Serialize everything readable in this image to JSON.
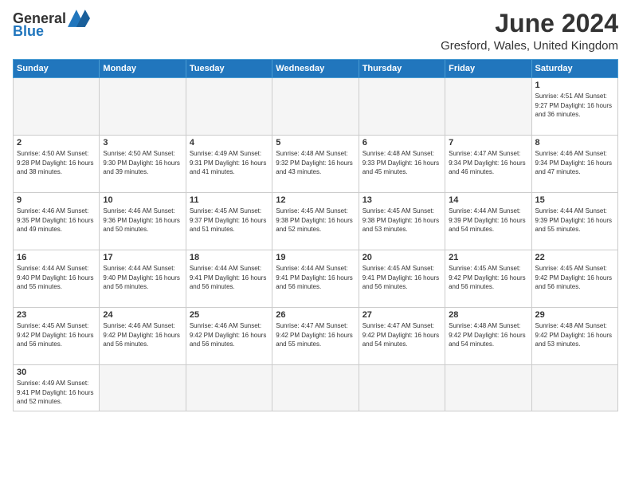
{
  "header": {
    "logo_general": "General",
    "logo_blue": "Blue",
    "month_title": "June 2024",
    "location": "Gresford, Wales, United Kingdom"
  },
  "days_of_week": [
    "Sunday",
    "Monday",
    "Tuesday",
    "Wednesday",
    "Thursday",
    "Friday",
    "Saturday"
  ],
  "weeks": [
    [
      {
        "day": "",
        "info": ""
      },
      {
        "day": "",
        "info": ""
      },
      {
        "day": "",
        "info": ""
      },
      {
        "day": "",
        "info": ""
      },
      {
        "day": "",
        "info": ""
      },
      {
        "day": "",
        "info": ""
      },
      {
        "day": "1",
        "info": "Sunrise: 4:51 AM\nSunset: 9:27 PM\nDaylight: 16 hours and 36 minutes."
      }
    ],
    [
      {
        "day": "2",
        "info": "Sunrise: 4:50 AM\nSunset: 9:28 PM\nDaylight: 16 hours and 38 minutes."
      },
      {
        "day": "3",
        "info": "Sunrise: 4:50 AM\nSunset: 9:30 PM\nDaylight: 16 hours and 39 minutes."
      },
      {
        "day": "4",
        "info": "Sunrise: 4:49 AM\nSunset: 9:31 PM\nDaylight: 16 hours and 41 minutes."
      },
      {
        "day": "5",
        "info": "Sunrise: 4:48 AM\nSunset: 9:32 PM\nDaylight: 16 hours and 43 minutes."
      },
      {
        "day": "6",
        "info": "Sunrise: 4:48 AM\nSunset: 9:33 PM\nDaylight: 16 hours and 45 minutes."
      },
      {
        "day": "7",
        "info": "Sunrise: 4:47 AM\nSunset: 9:34 PM\nDaylight: 16 hours and 46 minutes."
      },
      {
        "day": "8",
        "info": "Sunrise: 4:46 AM\nSunset: 9:34 PM\nDaylight: 16 hours and 47 minutes."
      }
    ],
    [
      {
        "day": "9",
        "info": "Sunrise: 4:46 AM\nSunset: 9:35 PM\nDaylight: 16 hours and 49 minutes."
      },
      {
        "day": "10",
        "info": "Sunrise: 4:46 AM\nSunset: 9:36 PM\nDaylight: 16 hours and 50 minutes."
      },
      {
        "day": "11",
        "info": "Sunrise: 4:45 AM\nSunset: 9:37 PM\nDaylight: 16 hours and 51 minutes."
      },
      {
        "day": "12",
        "info": "Sunrise: 4:45 AM\nSunset: 9:38 PM\nDaylight: 16 hours and 52 minutes."
      },
      {
        "day": "13",
        "info": "Sunrise: 4:45 AM\nSunset: 9:38 PM\nDaylight: 16 hours and 53 minutes."
      },
      {
        "day": "14",
        "info": "Sunrise: 4:44 AM\nSunset: 9:39 PM\nDaylight: 16 hours and 54 minutes."
      },
      {
        "day": "15",
        "info": "Sunrise: 4:44 AM\nSunset: 9:39 PM\nDaylight: 16 hours and 55 minutes."
      }
    ],
    [
      {
        "day": "16",
        "info": "Sunrise: 4:44 AM\nSunset: 9:40 PM\nDaylight: 16 hours and 55 minutes."
      },
      {
        "day": "17",
        "info": "Sunrise: 4:44 AM\nSunset: 9:40 PM\nDaylight: 16 hours and 56 minutes."
      },
      {
        "day": "18",
        "info": "Sunrise: 4:44 AM\nSunset: 9:41 PM\nDaylight: 16 hours and 56 minutes."
      },
      {
        "day": "19",
        "info": "Sunrise: 4:44 AM\nSunset: 9:41 PM\nDaylight: 16 hours and 56 minutes."
      },
      {
        "day": "20",
        "info": "Sunrise: 4:45 AM\nSunset: 9:41 PM\nDaylight: 16 hours and 56 minutes."
      },
      {
        "day": "21",
        "info": "Sunrise: 4:45 AM\nSunset: 9:42 PM\nDaylight: 16 hours and 56 minutes."
      },
      {
        "day": "22",
        "info": "Sunrise: 4:45 AM\nSunset: 9:42 PM\nDaylight: 16 hours and 56 minutes."
      }
    ],
    [
      {
        "day": "23",
        "info": "Sunrise: 4:45 AM\nSunset: 9:42 PM\nDaylight: 16 hours and 56 minutes."
      },
      {
        "day": "24",
        "info": "Sunrise: 4:46 AM\nSunset: 9:42 PM\nDaylight: 16 hours and 56 minutes."
      },
      {
        "day": "25",
        "info": "Sunrise: 4:46 AM\nSunset: 9:42 PM\nDaylight: 16 hours and 56 minutes."
      },
      {
        "day": "26",
        "info": "Sunrise: 4:47 AM\nSunset: 9:42 PM\nDaylight: 16 hours and 55 minutes."
      },
      {
        "day": "27",
        "info": "Sunrise: 4:47 AM\nSunset: 9:42 PM\nDaylight: 16 hours and 54 minutes."
      },
      {
        "day": "28",
        "info": "Sunrise: 4:48 AM\nSunset: 9:42 PM\nDaylight: 16 hours and 54 minutes."
      },
      {
        "day": "29",
        "info": "Sunrise: 4:48 AM\nSunset: 9:42 PM\nDaylight: 16 hours and 53 minutes."
      }
    ],
    [
      {
        "day": "30",
        "info": "Sunrise: 4:49 AM\nSunset: 9:41 PM\nDaylight: 16 hours and 52 minutes."
      },
      {
        "day": "",
        "info": ""
      },
      {
        "day": "",
        "info": ""
      },
      {
        "day": "",
        "info": ""
      },
      {
        "day": "",
        "info": ""
      },
      {
        "day": "",
        "info": ""
      },
      {
        "day": "",
        "info": ""
      }
    ]
  ]
}
